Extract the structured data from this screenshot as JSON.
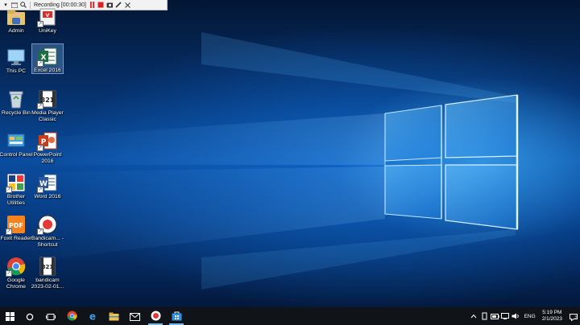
{
  "recording_bar": {
    "status_text": "Recording [00:00:30]",
    "icons": [
      "dropdown-icon",
      "folder-icon",
      "search-icon",
      "pause-icon",
      "stop-icon",
      "camera-icon",
      "pencil-icon",
      "close-icon"
    ]
  },
  "desktop": {
    "icons": [
      {
        "label": "Admin",
        "icon": "user-folder-icon"
      },
      {
        "label": "UniKey",
        "icon": "unikey-icon"
      },
      {
        "label": "This PC",
        "icon": "computer-icon"
      },
      {
        "label": "Excel 2016",
        "icon": "excel-icon"
      },
      {
        "label": "Recycle Bin",
        "icon": "recycle-bin-icon"
      },
      {
        "label": "Media Player Classic",
        "icon": "media-player-icon"
      },
      {
        "label": "Control Panel",
        "icon": "control-panel-icon"
      },
      {
        "label": "PowerPoint 2016",
        "icon": "powerpoint-icon"
      },
      {
        "label": "Brother Utilities",
        "icon": "brother-icon"
      },
      {
        "label": "Word 2016",
        "icon": "word-icon"
      },
      {
        "label": "Foxit Reader",
        "icon": "pdf-icon"
      },
      {
        "label": "Bandicam... - Shortcut",
        "icon": "bandicam-icon"
      },
      {
        "label": "Google Chrome",
        "icon": "chrome-icon"
      },
      {
        "label": "bandicam 2023-02-01...",
        "icon": "video-file-icon"
      }
    ]
  },
  "taskbar": {
    "pinned": [
      "start-icon",
      "search-icon",
      "task-view-icon",
      "chrome-icon",
      "edge-icon",
      "file-explorer-icon",
      "mail-icon",
      "bandicam-icon",
      "store-icon"
    ],
    "tray": {
      "language": "ENG",
      "time": "5:19 PM",
      "date": "2/1/2023"
    }
  },
  "colors": {
    "taskbar_bg": "#101418",
    "accent": "#76b9ed",
    "wallpaper_blue": "#0a4c9e"
  }
}
